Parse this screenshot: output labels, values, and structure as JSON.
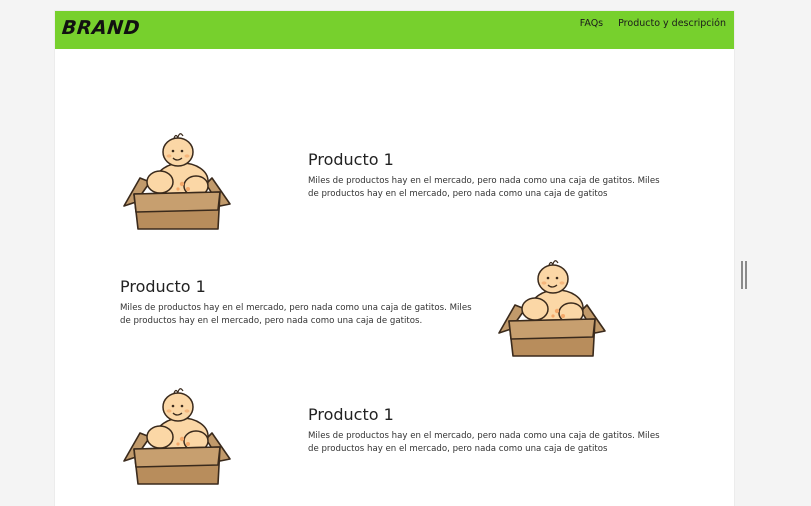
{
  "navbar": {
    "brand": "BRAND",
    "links": [
      "FAQs",
      "Producto y descripción"
    ],
    "color": "#77d02d"
  },
  "products": [
    {
      "title": "Producto 1",
      "description": "Miles de productos hay en el mercado, pero nada como una caja de gatitos. Miles de productos hay en el mercado, pero nada como una caja de gatitos",
      "image": "baby-in-box-illustration"
    },
    {
      "title": "Producto 1",
      "description": "Miles de productos hay en el mercado, pero nada como una caja de gatitos. Miles de productos hay en el mercado, pero nada como una caja de gatitos.",
      "image": "baby-in-box-illustration"
    },
    {
      "title": "Producto 1",
      "description": "Miles de productos hay en el mercado, pero nada como una caja de gatitos. Miles de productos hay en el mercado, pero nada como una caja de gatitos",
      "image": "baby-in-box-illustration"
    }
  ]
}
